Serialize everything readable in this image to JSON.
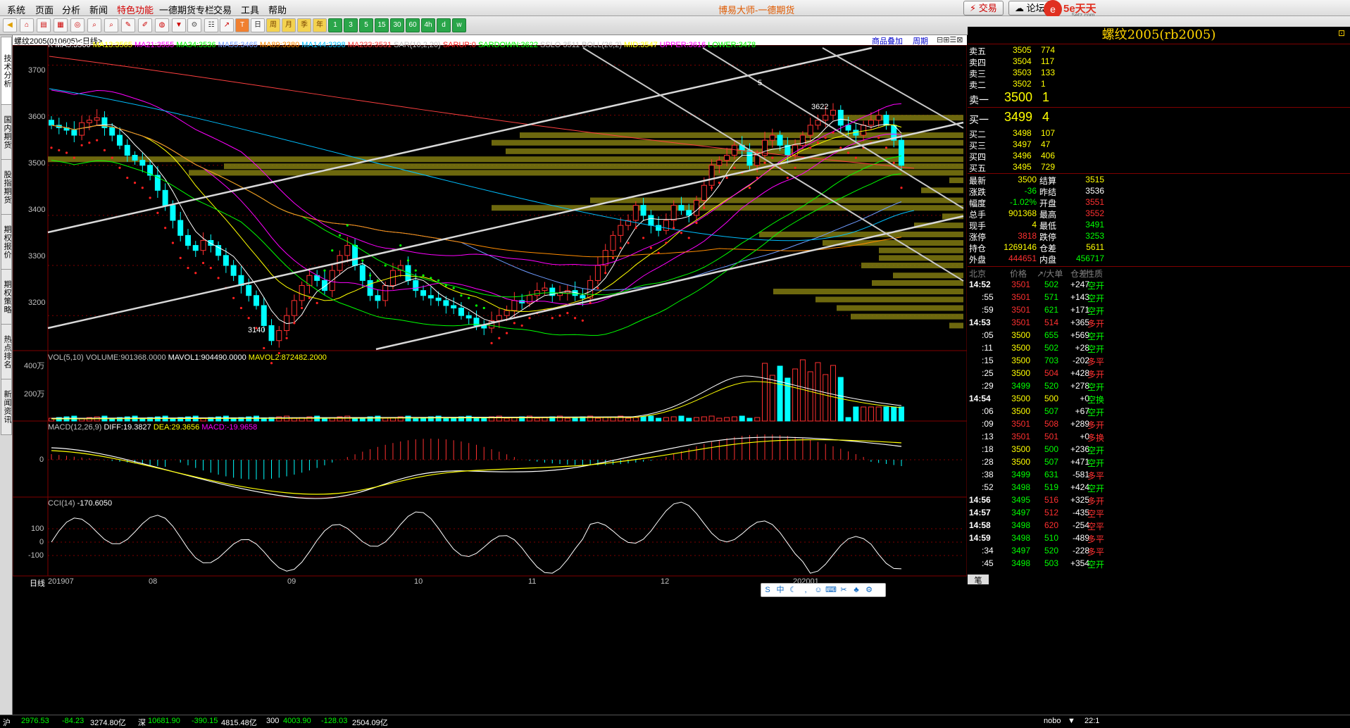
{
  "menu": {
    "items": [
      "系统",
      "页面",
      "分析",
      "新闻",
      "特色功能",
      "一德期货专栏",
      "交易",
      "工具",
      "帮助"
    ],
    "active_item": "特色功能",
    "window_title": "博易大师-一德期货",
    "trade_btn": "交易",
    "forum_btn": "论坛",
    "site_logo": "5e天天",
    "site_url": "5etz.com"
  },
  "toolbar": {
    "periods": [
      "周",
      "月",
      "季",
      "年",
      "1",
      "3",
      "5",
      "15",
      "30",
      "60",
      "4h",
      "d",
      "w"
    ]
  },
  "side_tabs": [
    "技术分析",
    "国内期货",
    "股指期货",
    "期权报价",
    "期权策略",
    "热点排名",
    "新闻资讯"
  ],
  "chart_header": {
    "symbol": "螺纹2005(010605)<日线>",
    "overlay_link": "商品叠加",
    "period_link": "周期"
  },
  "ma_line": {
    "prefix": "K",
    "items": [
      {
        "t": "MA5:3566",
        "c": "#ffffff"
      },
      {
        "t": "MA13:3565",
        "c": "#ffff00"
      },
      {
        "t": "MA21:3555",
        "c": "#ff00ff"
      },
      {
        "t": "MA34:3536",
        "c": "#00ff00"
      },
      {
        "t": "MA55:3465",
        "c": "#6e9bff"
      },
      {
        "t": "MA89:3380",
        "c": "#ff8c00"
      },
      {
        "t": "MA144:3398",
        "c": "#00bfff"
      },
      {
        "t": "MA233:3531",
        "c": "#ff4040"
      },
      {
        "t": "SAR(10,2,20)",
        "c": "#c0c0c0"
      },
      {
        "t": "SARUP:0",
        "c": "#ff2020"
      },
      {
        "t": "SARDOWN:3622",
        "c": "#00ff00"
      },
      {
        "t": "SSLO 3511",
        "c": "#c0c0c0"
      },
      {
        "t": "BOLL(26,2)",
        "c": "#c0c0c0"
      },
      {
        "t": "MID:3547",
        "c": "#ffff00"
      },
      {
        "t": "UPPER:3616",
        "c": "#ff00ff"
      },
      {
        "t": "LOWER:3478",
        "c": "#00ff00"
      }
    ]
  },
  "price_axis": [
    "3700",
    "3600",
    "3500",
    "3400",
    "3300",
    "3200"
  ],
  "price_marks": {
    "high": "3622",
    "low": "3140",
    "trend_label": "5"
  },
  "vol_line": {
    "items": [
      {
        "t": "VOL(5,10)",
        "c": "#c0c0c0"
      },
      {
        "t": "VOLUME:901368.0000",
        "c": "#c0c0c0"
      },
      {
        "t": "MAVOL1:904490.0000",
        "c": "#ffffff"
      },
      {
        "t": "MAVOL2:872482.2000",
        "c": "#ffff00"
      }
    ]
  },
  "vol_axis": [
    "400万",
    "200万"
  ],
  "macd_line": {
    "items": [
      {
        "t": "MACD(12,26,9)",
        "c": "#c0c0c0"
      },
      {
        "t": "DIFF:19.3827",
        "c": "#ffffff"
      },
      {
        "t": "DEA:29.3656",
        "c": "#ffff00"
      },
      {
        "t": "MACD:-19.9658",
        "c": "#ff00ff"
      }
    ]
  },
  "macd_axis": [
    "0"
  ],
  "cci_line": {
    "items": [
      {
        "t": "CCI(14)",
        "c": "#c0c0c0"
      },
      {
        "t": "-170.6050",
        "c": "#ffffff"
      }
    ]
  },
  "cci_axis": [
    "100",
    "0",
    "-100"
  ],
  "x_axis": {
    "period_label": "日线",
    "ticks": [
      "201907",
      "08",
      "09",
      "10",
      "11",
      "12",
      "202001"
    ]
  },
  "status_bar": {
    "a": "沪",
    "a_val": "2976.53",
    "a_chg": "-84.23",
    "a_amt": "3274.80亿",
    "b": "深",
    "b_val": "10681.90",
    "b_chg": "-390.15",
    "b_amt": "4815.48亿",
    "c": "300",
    "c_val": "4003.90",
    "c_chg": "-128.03",
    "c_amt": "2504.09亿",
    "right_a": "nobo",
    "right_b": "22:1",
    "tab_bottom": "笔"
  },
  "quote_panel": {
    "title": "螺纹2005(rb2005)",
    "asks": [
      {
        "l": "卖五",
        "p": "3505",
        "v": "774"
      },
      {
        "l": "卖四",
        "p": "3504",
        "v": "117"
      },
      {
        "l": "卖三",
        "p": "3503",
        "v": "133"
      },
      {
        "l": "卖二",
        "p": "3502",
        "v": "1"
      },
      {
        "l": "卖一",
        "p": "3500",
        "v": "1"
      }
    ],
    "bids": [
      {
        "l": "买一",
        "p": "3499",
        "v": "4"
      },
      {
        "l": "买二",
        "p": "3498",
        "v": "107"
      },
      {
        "l": "买三",
        "p": "3497",
        "v": "47"
      },
      {
        "l": "买四",
        "p": "3496",
        "v": "406"
      },
      {
        "l": "买五",
        "p": "3495",
        "v": "729"
      }
    ],
    "stats": [
      {
        "l1": "最新",
        "v1": "3500",
        "c1": "#ffff00",
        "l2": "结算",
        "v2": "3515",
        "c2": "#ffff00"
      },
      {
        "l1": "涨跌",
        "v1": "-36",
        "c1": "#00ff00",
        "l2": "昨结",
        "v2": "3536",
        "c2": "#ffffff"
      },
      {
        "l1": "幅度",
        "v1": "-1.02%",
        "c1": "#00ff00",
        "l2": "开盘",
        "v2": "3551",
        "c2": "#ff3030"
      },
      {
        "l1": "总手",
        "v1": "901368",
        "c1": "#ffff00",
        "l2": "最高",
        "v2": "3552",
        "c2": "#ff3030"
      },
      {
        "l1": "现手",
        "v1": "4",
        "c1": "#ffff00",
        "l2": "最低",
        "v2": "3491",
        "c2": "#00ff00"
      },
      {
        "l1": "涨停",
        "v1": "3818",
        "c1": "#ff3030",
        "l2": "跌停",
        "v2": "3253",
        "c2": "#00ff00"
      },
      {
        "l1": "持仓",
        "v1": "1269146",
        "c1": "#ffff00",
        "l2": "仓差",
        "v2": "5611",
        "c2": "#ffff00"
      },
      {
        "l1": "外盘",
        "v1": "444651",
        "c1": "#ff3030",
        "l2": "内盘",
        "v2": "456717",
        "c2": "#00ff00"
      }
    ],
    "tick_header": {
      "a": "北京",
      "b": "价格",
      "c": "↗/大单",
      "d": "仓差",
      "e": "性质"
    },
    "ticks": [
      {
        "t": "14:52",
        "p": "3501",
        "pc": "#ff3030",
        "v": "502",
        "vc": "#00ff00",
        "d": "+247",
        "n": "空开",
        "nc": "#00ff00"
      },
      {
        "t": ":55",
        "p": "3501",
        "pc": "#ff3030",
        "v": "571",
        "vc": "#00ff00",
        "d": "+143",
        "n": "空开",
        "nc": "#00ff00"
      },
      {
        "t": ":59",
        "p": "3501",
        "pc": "#ff3030",
        "v": "621",
        "vc": "#00ff00",
        "d": "+171",
        "n": "空开",
        "nc": "#00ff00"
      },
      {
        "t": "14:53",
        "p": "3501",
        "pc": "#ff3030",
        "v": "514",
        "vc": "#ff3030",
        "d": "+365",
        "n": "多开",
        "nc": "#ff3030"
      },
      {
        "t": ":05",
        "p": "3500",
        "pc": "#ffff00",
        "v": "655",
        "vc": "#00ff00",
        "d": "+569",
        "n": "空开",
        "nc": "#00ff00"
      },
      {
        "t": ":11",
        "p": "3500",
        "pc": "#ffff00",
        "v": "502",
        "vc": "#00ff00",
        "d": "+28",
        "n": "空开",
        "nc": "#00ff00"
      },
      {
        "t": ":15",
        "p": "3500",
        "pc": "#ffff00",
        "v": "703",
        "vc": "#00ff00",
        "d": "-202",
        "n": "多平",
        "nc": "#ff3030"
      },
      {
        "t": ":25",
        "p": "3500",
        "pc": "#ffff00",
        "v": "504",
        "vc": "#ff3030",
        "d": "+428",
        "n": "多开",
        "nc": "#ff3030"
      },
      {
        "t": ":29",
        "p": "3499",
        "pc": "#00ff00",
        "v": "520",
        "vc": "#00ff00",
        "d": "+278",
        "n": "空开",
        "nc": "#00ff00"
      },
      {
        "t": "14:54",
        "p": "3500",
        "pc": "#ffff00",
        "v": "500",
        "vc": "#ffff00",
        "d": "+0",
        "n": "空换",
        "nc": "#00ff00"
      },
      {
        "t": ":06",
        "p": "3500",
        "pc": "#ffff00",
        "v": "507",
        "vc": "#00ff00",
        "d": "+67",
        "n": "空开",
        "nc": "#00ff00"
      },
      {
        "t": ":09",
        "p": "3501",
        "pc": "#ff3030",
        "v": "508",
        "vc": "#ff3030",
        "d": "+289",
        "n": "多开",
        "nc": "#ff3030"
      },
      {
        "t": ":13",
        "p": "3501",
        "pc": "#ff3030",
        "v": "501",
        "vc": "#ff3030",
        "d": "+0",
        "n": "多换",
        "nc": "#ff3030"
      },
      {
        "t": ":18",
        "p": "3500",
        "pc": "#ffff00",
        "v": "500",
        "vc": "#00ff00",
        "d": "+236",
        "n": "空开",
        "nc": "#00ff00"
      },
      {
        "t": ":28",
        "p": "3500",
        "pc": "#ffff00",
        "v": "507",
        "vc": "#00ff00",
        "d": "+471",
        "n": "空开",
        "nc": "#00ff00"
      },
      {
        "t": ":38",
        "p": "3499",
        "pc": "#00ff00",
        "v": "631",
        "vc": "#00ff00",
        "d": "-581",
        "n": "多平",
        "nc": "#ff3030"
      },
      {
        "t": ":52",
        "p": "3498",
        "pc": "#00ff00",
        "v": "519",
        "vc": "#00ff00",
        "d": "+424",
        "n": "空开",
        "nc": "#00ff00"
      },
      {
        "t": "14:56",
        "p": "3495",
        "pc": "#00ff00",
        "v": "516",
        "vc": "#ff3030",
        "d": "+325",
        "n": "多开",
        "nc": "#ff3030"
      },
      {
        "t": "14:57",
        "p": "3497",
        "pc": "#00ff00",
        "v": "512",
        "vc": "#ff3030",
        "d": "-435",
        "n": "空平",
        "nc": "#ff3030"
      },
      {
        "t": "14:58",
        "p": "3498",
        "pc": "#00ff00",
        "v": "620",
        "vc": "#ff3030",
        "d": "-254",
        "n": "空平",
        "nc": "#ff3030"
      },
      {
        "t": "14:59",
        "p": "3498",
        "pc": "#00ff00",
        "v": "510",
        "vc": "#00ff00",
        "d": "-489",
        "n": "多平",
        "nc": "#ff3030"
      },
      {
        "t": ":34",
        "p": "3497",
        "pc": "#00ff00",
        "v": "520",
        "vc": "#00ff00",
        "d": "-228",
        "n": "多平",
        "nc": "#ff3030"
      },
      {
        "t": ":45",
        "p": "3498",
        "pc": "#00ff00",
        "v": "503",
        "vc": "#00ff00",
        "d": "+354",
        "n": "空开",
        "nc": "#00ff00"
      }
    ]
  },
  "colors": {
    "up": "#ff3030",
    "down": "#00ffff",
    "bg": "#000000",
    "grid": "#800000"
  },
  "chart_data": {
    "type": "candlestick",
    "price_range": [
      3130,
      3740
    ],
    "closes": [
      3580,
      3575,
      3570,
      3560,
      3585,
      3590,
      3595,
      3575,
      3560,
      3540,
      3520,
      3510,
      3500,
      3480,
      3450,
      3420,
      3390,
      3360,
      3340,
      3330,
      3350,
      3340,
      3320,
      3300,
      3280,
      3260,
      3240,
      3220,
      3180,
      3150,
      3170,
      3200,
      3230,
      3260,
      3280,
      3270,
      3250,
      3290,
      3320,
      3340,
      3300,
      3270,
      3240,
      3230,
      3260,
      3290,
      3300,
      3270,
      3250,
      3240,
      3235,
      3230,
      3220,
      3215,
      3200,
      3195,
      3180,
      3175,
      3190,
      3200,
      3210,
      3230,
      3225,
      3240,
      3250,
      3255,
      3240,
      3245,
      3250,
      3240,
      3235,
      3270,
      3300,
      3330,
      3360,
      3380,
      3390,
      3420,
      3400,
      3380,
      3370,
      3390,
      3420,
      3410,
      3400,
      3430,
      3460,
      3500,
      3510,
      3520,
      3540,
      3530,
      3500,
      3520,
      3550,
      3560,
      3540,
      3520,
      3540,
      3560,
      3580,
      3590,
      3600,
      3610,
      3580,
      3570,
      3560,
      3580,
      3590,
      3600,
      3580,
      3550,
      3500
    ]
  }
}
